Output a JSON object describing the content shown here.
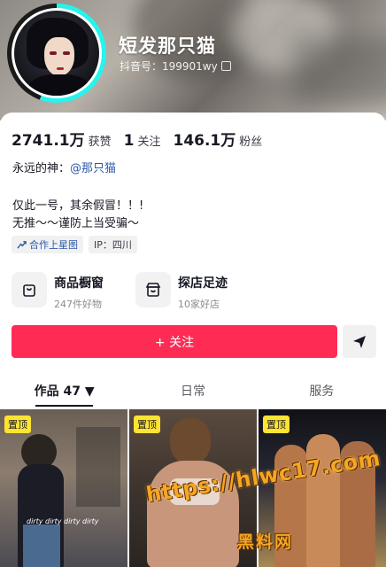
{
  "profile": {
    "nickname": "短发那只猫",
    "douyin_id": "抖音号：199901wy"
  },
  "stats": [
    {
      "num": "2741.1万",
      "label": "获赞"
    },
    {
      "num": "1",
      "label": "关注"
    },
    {
      "num": "146.1万",
      "label": "粉丝"
    }
  ],
  "bio": {
    "line1_prefix": "永远的神：",
    "line1_mention": "@那只猫",
    "line2": "仅此一号，其余假冒！！!",
    "line3": "无推～～谨防上当受骗～"
  },
  "tags": {
    "star": "合作上星图",
    "ip": "IP：四川"
  },
  "services": [
    {
      "title": "商品橱窗",
      "sub": "247件好物"
    },
    {
      "title": "探店足迹",
      "sub": "10家好店"
    }
  ],
  "actions": {
    "follow": "+ 关注"
  },
  "tabs": [
    {
      "label": "作品 47 ▼"
    },
    {
      "label": "日常"
    },
    {
      "label": "服务"
    }
  ],
  "videos": [
    {
      "pin": "置顶",
      "caption": "dirty dirty dirty dirty"
    },
    {
      "pin": "置顶"
    },
    {
      "pin": "置顶"
    }
  ],
  "watermark": {
    "url": "https://hlwc17.com",
    "name": "黑料网"
  }
}
